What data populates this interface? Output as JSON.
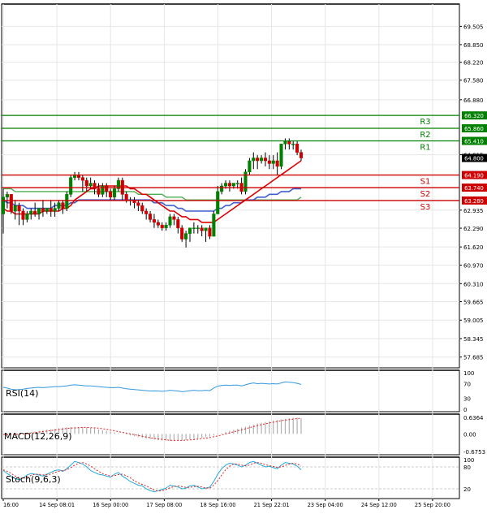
{
  "chart_data": {
    "type": "candlestick",
    "colors": {
      "up": "#008000",
      "down": "#cc0000",
      "grid": "#e6e6e6",
      "frame": "#000000",
      "pivot_r": "#008000",
      "pivot_s": "#cc0000",
      "ma_fast": "#dd0000",
      "ma_mid": "#4060d0",
      "ma_slow": "#4caf50",
      "rsi": "#3399dd",
      "macd_hist": "#b0b0b0",
      "macd_signal": "#dd2222",
      "stoch_k": "#22aadd",
      "stoch_d": "#dd2222"
    },
    "price_axis": {
      "min": 57.3,
      "max": 70.3,
      "ticks": [
        "69.505",
        "68.850",
        "68.220",
        "67.580",
        "66.880",
        "64.915",
        "62.935",
        "62.290",
        "61.620",
        "60.970",
        "60.310",
        "59.665",
        "59.005",
        "58.345",
        "57.685"
      ],
      "current_price": "64.800"
    },
    "pivot_levels": [
      {
        "name": "R3",
        "price": 66.32,
        "label": "66.320",
        "role": "resistance"
      },
      {
        "name": "R2",
        "price": 65.86,
        "label": "65.860",
        "role": "resistance"
      },
      {
        "name": "R1",
        "price": 65.41,
        "label": "65.410",
        "role": "resistance"
      },
      {
        "name": "S1",
        "price": 64.19,
        "label": "64.190",
        "role": "support"
      },
      {
        "name": "S2",
        "price": 63.74,
        "label": "63.740",
        "role": "support"
      },
      {
        "name": "S3",
        "price": 63.28,
        "label": "63.280",
        "role": "support"
      }
    ],
    "x_labels": [
      "16:00",
      "14 Sep 08:01",
      "16 Sep 00:00",
      "17 Sep 08:00",
      "18 Sep 16:00",
      "21 Sep 22:01",
      "23 Sep 04:00",
      "24 Sep 12:00",
      "25 Sep 20:00"
    ],
    "candles": [
      [
        62.8,
        63.7,
        63.4,
        62.1
      ],
      [
        63.4,
        63.6,
        63.5,
        63.0
      ],
      [
        63.5,
        63.5,
        62.9,
        62.8
      ],
      [
        62.9,
        63.3,
        63.1,
        62.6
      ],
      [
        63.1,
        63.2,
        62.9,
        62.4
      ],
      [
        62.9,
        63.0,
        62.6,
        62.4
      ],
      [
        62.6,
        62.9,
        62.8,
        62.5
      ],
      [
        62.8,
        63.0,
        62.9,
        62.6
      ],
      [
        62.9,
        63.2,
        62.8,
        62.7
      ],
      [
        62.8,
        63.0,
        63.0,
        62.6
      ],
      [
        63.0,
        63.3,
        62.9,
        62.7
      ],
      [
        62.9,
        63.0,
        63.0,
        62.8
      ],
      [
        63.0,
        63.3,
        62.9,
        62.7
      ],
      [
        62.9,
        63.2,
        63.0,
        62.7
      ],
      [
        63.0,
        63.3,
        63.2,
        62.9
      ],
      [
        63.2,
        63.3,
        63.0,
        62.8
      ],
      [
        63.0,
        63.6,
        63.5,
        62.9
      ],
      [
        63.5,
        64.2,
        64.1,
        63.4
      ],
      [
        64.1,
        64.3,
        64.2,
        64.0
      ],
      [
        64.2,
        64.3,
        64.1,
        64.0
      ],
      [
        64.1,
        64.2,
        64.0,
        63.6
      ],
      [
        64.0,
        64.1,
        63.8,
        63.6
      ],
      [
        63.8,
        64.1,
        63.9,
        63.7
      ],
      [
        63.9,
        64.0,
        63.7,
        63.5
      ],
      [
        63.7,
        63.9,
        63.5,
        63.4
      ],
      [
        63.5,
        63.9,
        63.8,
        63.4
      ],
      [
        63.8,
        63.9,
        63.6,
        63.4
      ],
      [
        63.6,
        63.7,
        63.4,
        63.3
      ],
      [
        63.4,
        63.8,
        63.7,
        63.3
      ],
      [
        63.7,
        64.1,
        64.0,
        63.6
      ],
      [
        64.0,
        64.1,
        63.5,
        63.3
      ],
      [
        63.5,
        63.6,
        63.3,
        63.2
      ],
      [
        63.3,
        63.4,
        63.3,
        63.1
      ],
      [
        63.3,
        63.4,
        63.2,
        63.0
      ],
      [
        63.2,
        63.3,
        63.1,
        62.9
      ],
      [
        63.1,
        63.2,
        62.9,
        62.8
      ],
      [
        62.9,
        63.0,
        62.8,
        62.6
      ],
      [
        62.8,
        62.9,
        62.6,
        62.5
      ],
      [
        62.6,
        62.8,
        62.5,
        62.3
      ],
      [
        62.5,
        62.6,
        62.4,
        62.3
      ],
      [
        62.4,
        62.5,
        62.3,
        62.2
      ],
      [
        62.3,
        62.5,
        62.4,
        62.2
      ],
      [
        62.4,
        62.8,
        62.7,
        62.3
      ],
      [
        62.7,
        62.8,
        62.6,
        62.4
      ],
      [
        62.6,
        62.7,
        62.3,
        62.1
      ],
      [
        62.3,
        62.4,
        61.9,
        61.8
      ],
      [
        61.9,
        62.2,
        62.1,
        61.6
      ],
      [
        62.1,
        62.2,
        62.3,
        61.8
      ],
      [
        62.3,
        62.5,
        62.3,
        62.1
      ],
      [
        62.3,
        62.4,
        62.3,
        62.1
      ],
      [
        62.3,
        62.4,
        62.2,
        62.0
      ],
      [
        62.2,
        62.3,
        62.3,
        61.8
      ],
      [
        62.3,
        62.4,
        62.0,
        61.9
      ],
      [
        62.0,
        62.9,
        62.8,
        62.0
      ],
      [
        62.8,
        63.8,
        63.6,
        62.8
      ],
      [
        63.6,
        63.9,
        63.8,
        63.5
      ],
      [
        63.8,
        64.0,
        63.9,
        63.7
      ],
      [
        63.9,
        64.0,
        63.8,
        63.6
      ],
      [
        63.8,
        63.9,
        63.9,
        63.7
      ],
      [
        63.9,
        64.0,
        63.9,
        63.7
      ],
      [
        63.9,
        64.1,
        63.6,
        63.5
      ],
      [
        63.6,
        64.4,
        64.3,
        63.5
      ],
      [
        64.3,
        64.8,
        64.7,
        64.2
      ],
      [
        64.7,
        65.0,
        64.8,
        64.4
      ],
      [
        64.8,
        64.9,
        64.7,
        64.4
      ],
      [
        64.7,
        64.9,
        64.8,
        64.6
      ],
      [
        64.8,
        65.0,
        64.7,
        64.5
      ],
      [
        64.7,
        64.9,
        64.6,
        64.4
      ],
      [
        64.6,
        64.9,
        64.7,
        64.4
      ],
      [
        64.7,
        65.0,
        64.5,
        64.2
      ],
      [
        64.5,
        65.1,
        65.3,
        64.4
      ],
      [
        65.3,
        65.5,
        65.4,
        65.1
      ],
      [
        65.4,
        65.5,
        65.3,
        65.1
      ],
      [
        65.3,
        65.4,
        65.3,
        65.1
      ],
      [
        65.3,
        65.4,
        65.0,
        64.9
      ],
      [
        65.0,
        65.1,
        64.8,
        64.7
      ]
    ],
    "ma_fast": [
      63.0,
      62.9,
      62.9,
      62.8,
      62.8,
      62.8,
      62.8,
      62.8,
      62.8,
      62.8,
      62.9,
      62.9,
      62.9,
      62.9,
      62.9,
      63.0,
      63.0,
      63.1,
      63.3,
      63.4,
      63.5,
      63.6,
      63.7,
      63.7,
      63.8,
      63.8,
      63.8,
      63.8,
      63.8,
      63.8,
      63.8,
      63.8,
      63.7,
      63.7,
      63.6,
      63.5,
      63.5,
      63.4,
      63.3,
      63.2,
      63.1,
      63.0,
      62.9,
      62.9,
      62.8,
      62.7,
      62.7,
      62.6,
      62.6,
      62.6,
      62.5,
      62.5,
      62.5,
      62.5,
      62.6,
      62.7,
      62.8,
      62.9,
      63.0,
      63.1,
      63.2,
      63.3,
      63.4,
      63.5,
      63.6,
      63.7,
      63.8,
      63.9,
      64.0,
      64.1,
      64.2,
      64.3,
      64.4,
      64.5,
      64.6,
      64.7
    ],
    "ma_mid": [
      63.3,
      63.2,
      63.2,
      63.1,
      63.1,
      63.1,
      63.0,
      63.0,
      63.0,
      63.0,
      63.0,
      63.0,
      63.0,
      63.1,
      63.1,
      63.1,
      63.1,
      63.2,
      63.2,
      63.3,
      63.3,
      63.3,
      63.3,
      63.3,
      63.3,
      63.3,
      63.3,
      63.3,
      63.3,
      63.3,
      63.3,
      63.3,
      63.3,
      63.3,
      63.3,
      63.3,
      63.3,
      63.3,
      63.2,
      63.2,
      63.2,
      63.1,
      63.1,
      63.1,
      63.0,
      63.0,
      62.9,
      62.9,
      62.9,
      62.9,
      62.9,
      62.9,
      62.9,
      62.9,
      63.0,
      63.0,
      63.1,
      63.1,
      63.2,
      63.2,
      63.2,
      63.3,
      63.3,
      63.3,
      63.4,
      63.4,
      63.4,
      63.5,
      63.5,
      63.5,
      63.6,
      63.6,
      63.6,
      63.7,
      63.7,
      63.7
    ],
    "ma_slow": [
      63.7,
      63.7,
      63.7,
      63.6,
      63.6,
      63.6,
      63.6,
      63.6,
      63.6,
      63.6,
      63.6,
      63.6,
      63.6,
      63.6,
      63.6,
      63.6,
      63.6,
      63.6,
      63.6,
      63.6,
      63.6,
      63.6,
      63.6,
      63.6,
      63.6,
      63.6,
      63.6,
      63.6,
      63.6,
      63.6,
      63.6,
      63.6,
      63.6,
      63.6,
      63.5,
      63.5,
      63.5,
      63.5,
      63.5,
      63.5,
      63.5,
      63.4,
      63.4,
      63.4,
      63.4,
      63.4,
      63.3,
      63.3,
      63.3,
      63.3,
      63.3,
      63.3,
      63.3,
      63.3,
      63.3,
      63.3,
      63.3,
      63.3,
      63.3,
      63.3,
      63.3,
      63.3,
      63.3,
      63.3,
      63.3,
      63.3,
      63.3,
      63.3,
      63.3,
      63.3,
      63.3,
      63.3,
      63.3,
      63.3,
      63.3,
      63.4
    ],
    "rsi": {
      "label": "RSI(14)",
      "ticks": [
        "100",
        "70",
        "30",
        "0"
      ],
      "min": 0,
      "max": 100,
      "values": [
        60,
        58,
        55,
        53,
        54,
        55,
        57,
        58,
        59,
        60,
        59,
        60,
        61,
        62,
        62,
        63,
        64,
        66,
        67,
        66,
        65,
        64,
        64,
        63,
        62,
        61,
        60,
        59,
        59,
        60,
        58,
        56,
        55,
        54,
        53,
        52,
        51,
        50,
        50,
        50,
        49,
        50,
        52,
        51,
        50,
        48,
        49,
        51,
        52,
        51,
        51,
        52,
        51,
        58,
        63,
        65,
        66,
        65,
        66,
        66,
        64,
        67,
        70,
        72,
        70,
        71,
        70,
        69,
        70,
        69,
        72,
        75,
        74,
        73,
        71,
        68
      ]
    },
    "macd": {
      "label": "MACD(12,26,9)",
      "ticks": [
        "0.6364",
        "0.00",
        "-0.6753"
      ],
      "min": -0.6753,
      "max": 0.6364,
      "hist": [
        -0.02,
        -0.02,
        -0.02,
        -0.01,
        0.01,
        0.03,
        0.05,
        0.08,
        0.1,
        0.12,
        0.14,
        0.16,
        0.18,
        0.2,
        0.22,
        0.24,
        0.25,
        0.26,
        0.27,
        0.27,
        0.26,
        0.25,
        0.23,
        0.21,
        0.18,
        0.15,
        0.12,
        0.09,
        0.06,
        0.03,
        0.0,
        -0.03,
        -0.06,
        -0.09,
        -0.12,
        -0.15,
        -0.18,
        -0.2,
        -0.22,
        -0.24,
        -0.25,
        -0.26,
        -0.27,
        -0.27,
        -0.26,
        -0.25,
        -0.24,
        -0.22,
        -0.2,
        -0.18,
        -0.16,
        -0.13,
        -0.1,
        -0.06,
        -0.02,
        0.03,
        0.08,
        0.12,
        0.16,
        0.2,
        0.24,
        0.28,
        0.32,
        0.36,
        0.4,
        0.43,
        0.46,
        0.49,
        0.52,
        0.54,
        0.56,
        0.58,
        0.6,
        0.62,
        0.63,
        0.6
      ],
      "signal": [
        -0.02,
        -0.02,
        -0.02,
        -0.02,
        -0.01,
        0.0,
        0.01,
        0.03,
        0.05,
        0.07,
        0.09,
        0.11,
        0.13,
        0.15,
        0.17,
        0.19,
        0.21,
        0.22,
        0.23,
        0.24,
        0.25,
        0.25,
        0.24,
        0.23,
        0.22,
        0.2,
        0.18,
        0.15,
        0.12,
        0.09,
        0.06,
        0.03,
        0.0,
        -0.03,
        -0.06,
        -0.09,
        -0.12,
        -0.15,
        -0.17,
        -0.19,
        -0.21,
        -0.23,
        -0.24,
        -0.25,
        -0.25,
        -0.25,
        -0.24,
        -0.23,
        -0.22,
        -0.2,
        -0.18,
        -0.16,
        -0.14,
        -0.11,
        -0.08,
        -0.04,
        0.0,
        0.04,
        0.08,
        0.12,
        0.16,
        0.2,
        0.24,
        0.28,
        0.32,
        0.36,
        0.39,
        0.42,
        0.45,
        0.48,
        0.51,
        0.53,
        0.55,
        0.57,
        0.59,
        0.6
      ]
    },
    "stoch": {
      "label": "Stoch(9,6,3)",
      "ticks": [
        "100",
        "80",
        "20"
      ],
      "min": 0,
      "max": 100,
      "k": [
        70,
        62,
        55,
        48,
        45,
        50,
        58,
        62,
        60,
        58,
        55,
        60,
        65,
        70,
        72,
        68,
        75,
        85,
        95,
        92,
        88,
        80,
        70,
        65,
        60,
        58,
        55,
        52,
        60,
        65,
        55,
        48,
        40,
        35,
        30,
        28,
        20,
        15,
        12,
        15,
        18,
        22,
        30,
        28,
        25,
        20,
        22,
        28,
        30,
        25,
        20,
        22,
        25,
        40,
        60,
        75,
        85,
        90,
        88,
        85,
        80,
        85,
        92,
        95,
        90,
        85,
        80,
        82,
        78,
        75,
        85,
        92,
        90,
        88,
        82,
        72
      ],
      "d": [
        72,
        68,
        62,
        55,
        50,
        48,
        52,
        57,
        60,
        60,
        58,
        58,
        60,
        65,
        68,
        70,
        72,
        78,
        85,
        90,
        92,
        88,
        82,
        75,
        68,
        62,
        58,
        55,
        56,
        59,
        60,
        56,
        50,
        42,
        36,
        32,
        28,
        22,
        17,
        14,
        15,
        18,
        23,
        26,
        28,
        26,
        24,
        24,
        26,
        27,
        25,
        22,
        22,
        30,
        42,
        58,
        72,
        82,
        88,
        88,
        85,
        83,
        85,
        90,
        92,
        90,
        86,
        83,
        81,
        79,
        80,
        84,
        88,
        90,
        88,
        82
      ]
    }
  }
}
